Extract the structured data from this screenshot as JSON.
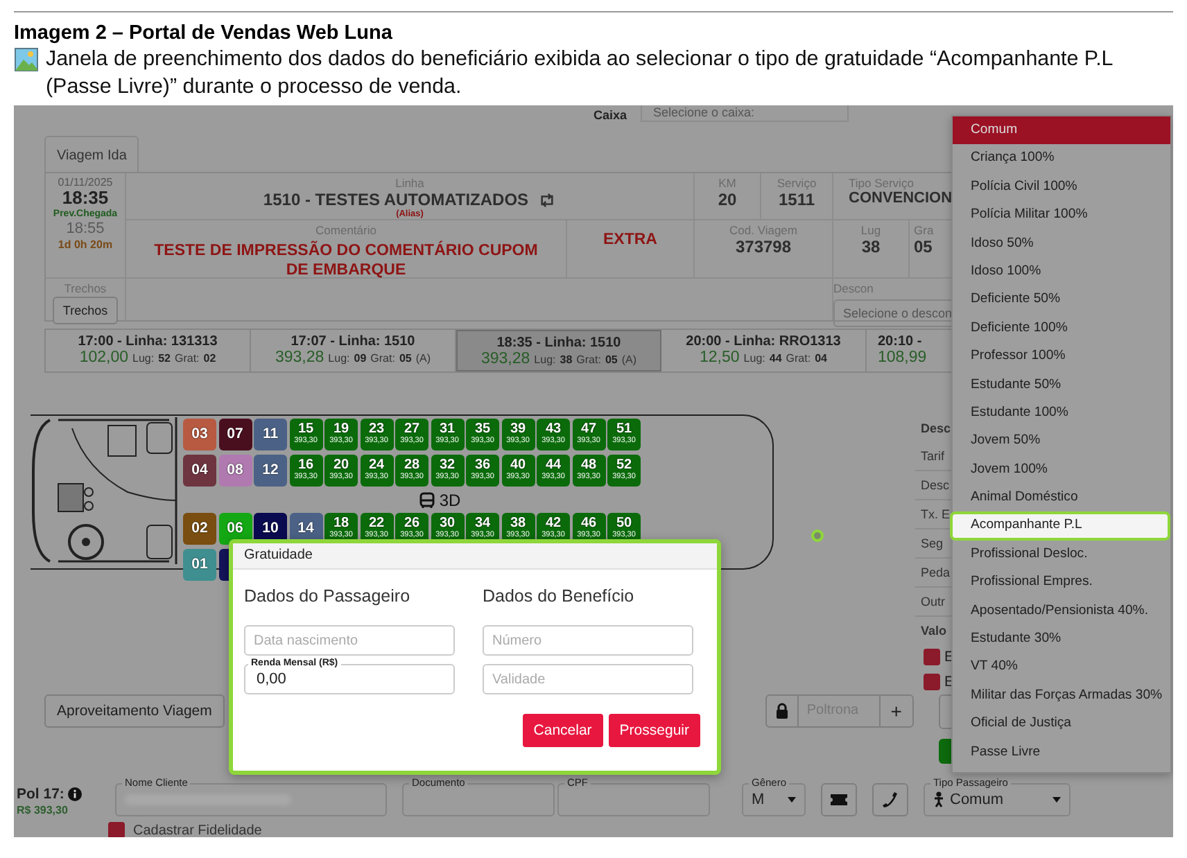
{
  "document": {
    "title": "Imagem 2 – Portal de Vendas Web Luna",
    "caption": "Janela de preenchimento dos dados do beneficiário exibida ao selecionar o tipo de gratuidade “Acompanhante P.L (Passe Livre)” durante o processo de venda."
  },
  "caixa": {
    "label": "Caixa",
    "placeholder": "Selecione o caixa:"
  },
  "tabs": [
    {
      "label": "Viagem Ida",
      "selected": true
    }
  ],
  "trip": {
    "date": "01/11/2025",
    "time": "18:35",
    "arrival_label": "Prev.Chegada",
    "arrival_time": "18:55",
    "duration": "1d 0h 20m",
    "linha_label": "Linha",
    "linha": "1510 - TESTES AUTOMATIZADOS",
    "alias": "(Alias)",
    "km_label": "KM",
    "km": "20",
    "servico_label": "Serviço",
    "servico": "1511",
    "tipo_label": "Tipo Serviço",
    "tipo": "CONVENCION",
    "comentario_label": "Comentário",
    "comentario": "TESTE DE IMPRESSÃO DO COMENTÁRIO CUPOM DE EMBARQUE",
    "extra": "EXTRA",
    "cod_label": "Cod. Viagem",
    "cod": "373798",
    "lug_label": "Lug",
    "lug": "38",
    "grat_label": "Gra",
    "grat": "05",
    "trechos_label": "Trechos",
    "trechos_button": "Trechos",
    "desconto_label": "Descon",
    "desconto_placeholder": "Selecione o descon"
  },
  "departures": [
    {
      "title": "17:00 - Linha: 131313",
      "price": "102,00",
      "lug_label": "Lug:",
      "lug": "52",
      "grat_label": "Grat:",
      "grat": "02",
      "selected": false
    },
    {
      "title": "17:07 - Linha: 1510",
      "price": "393,28",
      "lug_label": "Lug:",
      "lug": "09",
      "grat_label": "Grat:",
      "grat": "05",
      "suffix": "(A)",
      "selected": false
    },
    {
      "title": "18:35 - Linha: 1510",
      "price": "393,28",
      "lug_label": "Lug:",
      "lug": "38",
      "grat_label": "Grat:",
      "grat": "05",
      "suffix": "(A)",
      "selected": true
    },
    {
      "title": "20:00 - Linha: RRO1313",
      "price": "12,50",
      "lug_label": "Lug:",
      "lug": "44",
      "grat_label": "Grat:",
      "grat": "04",
      "selected": false
    },
    {
      "title": "20:10 -",
      "price": "108,99",
      "selected": false
    }
  ],
  "seat_rows": [
    [
      {
        "number": "03",
        "color": "#b85a42"
      },
      {
        "number": "07",
        "color": "#4a0f1f"
      },
      {
        "number": "11",
        "color": "#4b6286"
      },
      {
        "number": "15",
        "price": "393,30",
        "color": "#0b6b0b"
      },
      {
        "number": "19",
        "price": "393,30",
        "color": "#0b6b0b"
      },
      {
        "number": "23",
        "price": "393,30",
        "color": "#0b6b0b"
      },
      {
        "number": "27",
        "price": "393,30",
        "color": "#0b6b0b"
      },
      {
        "number": "31",
        "price": "393,30",
        "color": "#0b6b0b"
      },
      {
        "number": "35",
        "price": "393,30",
        "color": "#0b6b0b"
      },
      {
        "number": "39",
        "price": "393,30",
        "color": "#0b6b0b"
      },
      {
        "number": "43",
        "price": "393,30",
        "color": "#0b6b0b"
      },
      {
        "number": "47",
        "price": "393,30",
        "color": "#0b6b0b"
      },
      {
        "number": "51",
        "price": "393,30",
        "color": "#0b6b0b"
      }
    ],
    [
      {
        "number": "04",
        "color": "#6e3540"
      },
      {
        "number": "08",
        "color": "#b07ab0"
      },
      {
        "number": "12",
        "color": "#4b6286"
      },
      {
        "number": "16",
        "price": "393,30",
        "color": "#0b6b0b"
      },
      {
        "number": "20",
        "price": "393,30",
        "color": "#0b6b0b"
      },
      {
        "number": "24",
        "price": "393,30",
        "color": "#0b6b0b"
      },
      {
        "number": "28",
        "price": "393,30",
        "color": "#0b6b0b"
      },
      {
        "number": "32",
        "price": "393,30",
        "color": "#0b6b0b"
      },
      {
        "number": "36",
        "price": "393,30",
        "color": "#0b6b0b"
      },
      {
        "number": "40",
        "price": "393,30",
        "color": "#0b6b0b"
      },
      {
        "number": "44",
        "price": "393,30",
        "color": "#0b6b0b"
      },
      {
        "number": "48",
        "price": "393,30",
        "color": "#0b6b0b"
      },
      {
        "number": "52",
        "price": "393,30",
        "color": "#0b6b0b"
      }
    ],
    [
      {
        "number": "02",
        "color": "#7a4e10"
      },
      {
        "number": "06",
        "color": "#14a814"
      },
      {
        "number": "10",
        "color": "#0a0a50"
      },
      {
        "number": "14",
        "color": "#4b6286"
      },
      {
        "number": "18",
        "price": "393,30",
        "color": "#0b6b0b"
      },
      {
        "number": "22",
        "price": "393,30",
        "color": "#0b6b0b"
      },
      {
        "number": "26",
        "price": "393,30",
        "color": "#0b6b0b"
      },
      {
        "number": "30",
        "price": "393,30",
        "color": "#0b6b0b"
      },
      {
        "number": "34",
        "price": "393,30",
        "color": "#0b6b0b"
      },
      {
        "number": "38",
        "price": "393,30",
        "color": "#0b6b0b"
      },
      {
        "number": "42",
        "price": "393,30",
        "color": "#0b6b0b"
      },
      {
        "number": "46",
        "price": "393,30",
        "color": "#0b6b0b"
      },
      {
        "number": "50",
        "price": "393,30",
        "color": "#0b6b0b"
      }
    ],
    [
      {
        "number": "01",
        "color": "#3f8f90"
      },
      {
        "color": "#14145a"
      }
    ]
  ],
  "deck_label": "3D",
  "summary": {
    "items": [
      {
        "label": "Desc",
        "bold": true
      },
      {
        "label": "Tarif",
        "bold": false
      },
      {
        "label": "Desc",
        "bold": false
      },
      {
        "label": "Tx. E",
        "bold": false
      },
      {
        "label": "Seg",
        "bold": false
      },
      {
        "label": "Peda",
        "bold": false
      },
      {
        "label": "Outr",
        "bold": false
      },
      {
        "label": "Valo",
        "bold": true
      }
    ],
    "checks": [
      {
        "label": "E",
        "checked": true
      },
      {
        "label": "E",
        "checked": true
      }
    ]
  },
  "actions": {
    "aproveitamento": "Aproveitamento Viagem",
    "poltrona_placeholder": "Poltrona",
    "add": "+"
  },
  "passenger": {
    "label": "Pol 17:",
    "price": "R$ 393,30",
    "nome_label": "Nome Cliente",
    "documento_label": "Documento",
    "cpf_label": "CPF",
    "genero_label": "Gênero",
    "genero": "M",
    "tipo_label": "Tipo Passageiro",
    "tipo": "Comum",
    "fidelidade": {
      "label": "Cadastrar Fidelidade",
      "checked": true
    }
  },
  "modal": {
    "title": "Gratuidade",
    "passenger_heading": "Dados do Passageiro",
    "benefit_heading": "Dados do Benefício",
    "birth_placeholder": "Data nascimento",
    "income_label": "Renda Mensal (R$)",
    "income": "0,00",
    "number_placeholder": "Número",
    "validity_placeholder": "Validade",
    "cancel": "Cancelar",
    "proceed": "Prosseguir"
  },
  "dropdown": [
    {
      "label": "Comum",
      "selected": true,
      "highlighted": false
    },
    {
      "label": "Criança 100%",
      "selected": false,
      "highlighted": false
    },
    {
      "label": "Polícia Civil 100%",
      "selected": false,
      "highlighted": false
    },
    {
      "label": "Polícia Militar 100%",
      "selected": false,
      "highlighted": false
    },
    {
      "label": "Idoso 50%",
      "selected": false,
      "highlighted": false
    },
    {
      "label": "Idoso 100%",
      "selected": false,
      "highlighted": false
    },
    {
      "label": "Deficiente 50%",
      "selected": false,
      "highlighted": false
    },
    {
      "label": "Deficiente 100%",
      "selected": false,
      "highlighted": false
    },
    {
      "label": "Professor 100%",
      "selected": false,
      "highlighted": false
    },
    {
      "label": "Estudante 50%",
      "selected": false,
      "highlighted": false
    },
    {
      "label": "Estudante 100%",
      "selected": false,
      "highlighted": false
    },
    {
      "label": "Jovem 50%",
      "selected": false,
      "highlighted": false
    },
    {
      "label": "Jovem 100%",
      "selected": false,
      "highlighted": false
    },
    {
      "label": "Animal Doméstico",
      "selected": false,
      "highlighted": false
    },
    {
      "label": "Acompanhante P.L",
      "selected": false,
      "highlighted": true
    },
    {
      "label": "Profissional Desloc.",
      "selected": false,
      "highlighted": false
    },
    {
      "label": "Profissional Empres.",
      "selected": false,
      "highlighted": false
    },
    {
      "label": "Aposentado/Pensionista 40%.",
      "selected": false,
      "highlighted": false
    },
    {
      "label": "Estudante 30%",
      "selected": false,
      "highlighted": false
    },
    {
      "label": "VT 40%",
      "selected": false,
      "highlighted": false
    },
    {
      "label": "Militar das Forças Armadas 30%",
      "selected": false,
      "highlighted": false
    },
    {
      "label": "Oficial de Justiça",
      "selected": false,
      "highlighted": false
    },
    {
      "label": "Passe Livre",
      "selected": false,
      "highlighted": false
    }
  ]
}
